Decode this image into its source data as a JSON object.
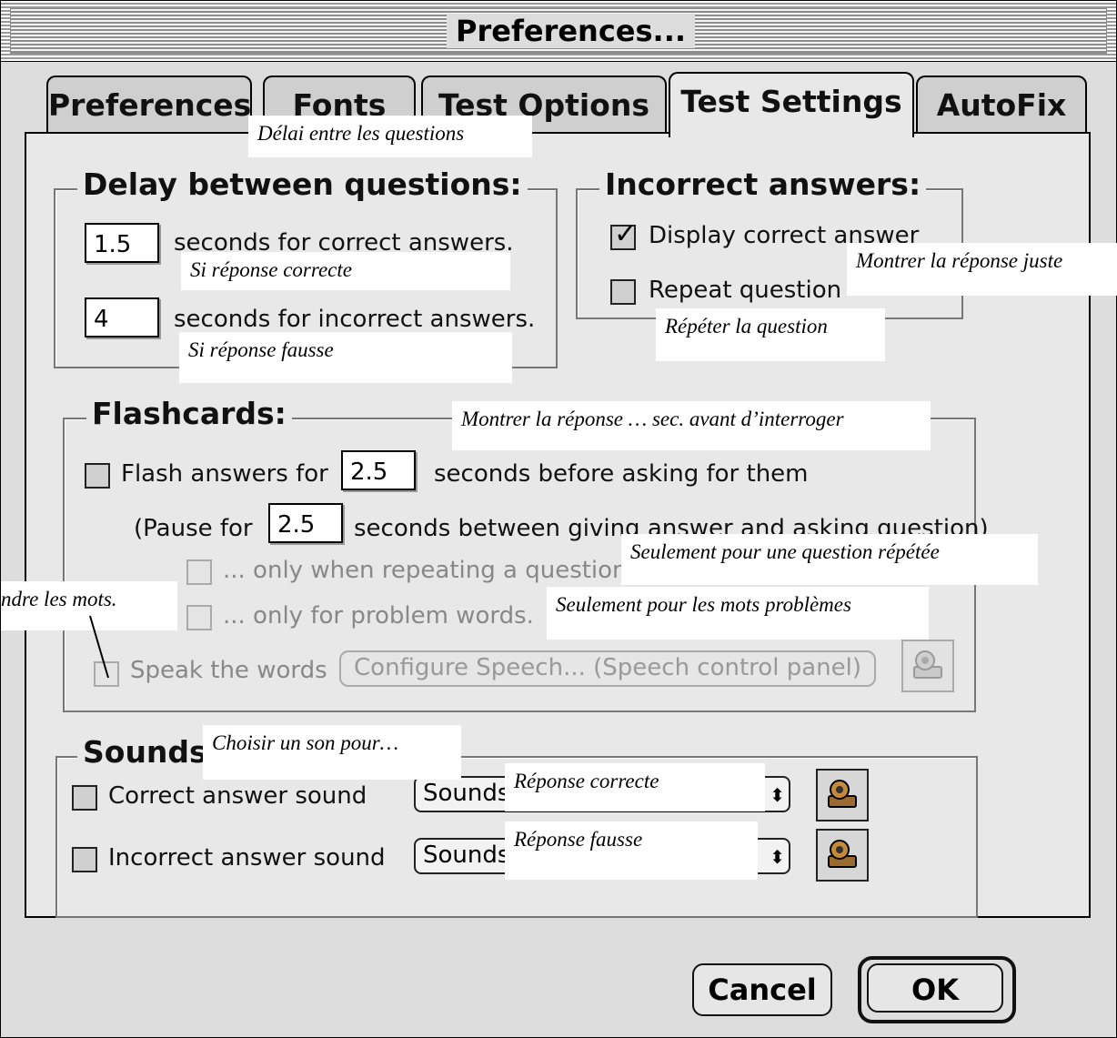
{
  "window": {
    "title": "Preferences..."
  },
  "tabs": [
    {
      "label": "Preferences",
      "active": false
    },
    {
      "label": "Fonts",
      "active": false
    },
    {
      "label": "Test Options",
      "active": false
    },
    {
      "label": "Test Settings",
      "active": true
    },
    {
      "label": "AutoFix",
      "active": false
    }
  ],
  "delay": {
    "legend": "Delay between questions:",
    "correct_value": "1.5",
    "correct_label": "seconds for correct answers.",
    "incorrect_value": "4",
    "incorrect_label": "seconds for incorrect answers."
  },
  "incorrect_answers": {
    "legend": "Incorrect answers:",
    "display_correct_label": "Display correct answer",
    "display_correct_checked": true,
    "repeat_label": "Repeat question",
    "repeat_checked": false
  },
  "flashcards": {
    "legend": "Flashcards:",
    "flash_label_before": "Flash answers for",
    "flash_value": "2.5",
    "flash_label_after": "seconds before asking for them",
    "pause_label_before": "(Pause for",
    "pause_value": "2.5",
    "pause_label_after": "seconds between giving answer and asking question)",
    "only_repeating_label": "... only when repeating a question",
    "only_problem_label": "... only for problem words.",
    "speak_label": "Speak the words",
    "configure_speech_label": "Configure Speech... (Speech control panel)"
  },
  "sounds": {
    "legend": "Sounds:",
    "correct_label": "Correct answer sound",
    "correct_popup": "Sounds",
    "incorrect_label": "Incorrect answer sound",
    "incorrect_popup": "Sounds"
  },
  "buttons": {
    "cancel": "Cancel",
    "ok": "OK"
  },
  "annotations": {
    "delay": "Délai entre les questions",
    "correct": "Si réponse correcte",
    "incorrect": "Si réponse fausse",
    "display_correct": "Montrer la réponse juste",
    "repeat": "Répéter la question",
    "flash": "Montrer la réponse … sec. avant d’interroger",
    "only_repeating": "Seulement pour une question répétée",
    "only_problem": "Seulement pour les mots problèmes",
    "speak": "ndre les mots.",
    "sounds": "Choisir un son pour…",
    "sound_correct": "Réponse correcte",
    "sound_incorrect": "Réponse fausse"
  },
  "icons": [
    "checkmark-icon",
    "speaker-icon",
    "popup-arrows-icon"
  ]
}
